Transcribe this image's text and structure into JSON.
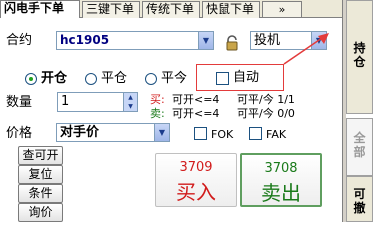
{
  "tabs": [
    "闪电手下单",
    "三键下单",
    "传统下单",
    "快鼠下单"
  ],
  "tab_more": "»",
  "form": {
    "contract_label": "合约",
    "contract_value": "hc1905",
    "account_type": "投机",
    "open_label": "开仓",
    "close_label": "平仓",
    "close_today_label": "平今",
    "auto_label": "自动",
    "qty_label": "数量",
    "qty_value": "1",
    "buy_info_prefix": "买:",
    "buy_open_limit": "可开<=4",
    "buy_close_info": "可平/今 1/1",
    "sell_info_prefix": "卖:",
    "sell_open_limit": "可开<=4",
    "sell_close_info": "可平/今 0/0",
    "price_label": "价格",
    "price_value": "对手价",
    "fok_label": "FOK",
    "fak_label": "FAK"
  },
  "buttons": {
    "query_open": "查可开",
    "reset": "复位",
    "condition": "条件",
    "inquiry": "询价"
  },
  "buy": {
    "price": "3709",
    "label": "买入"
  },
  "sell": {
    "price": "3708",
    "label": "卖出"
  },
  "side": {
    "position": "持\n仓",
    "all": "全\n部",
    "withdraw": "可\n撤"
  },
  "colors": {
    "buy": "#d11b1b",
    "sell": "#1a7a1a",
    "annotation": "#e33b3b"
  }
}
